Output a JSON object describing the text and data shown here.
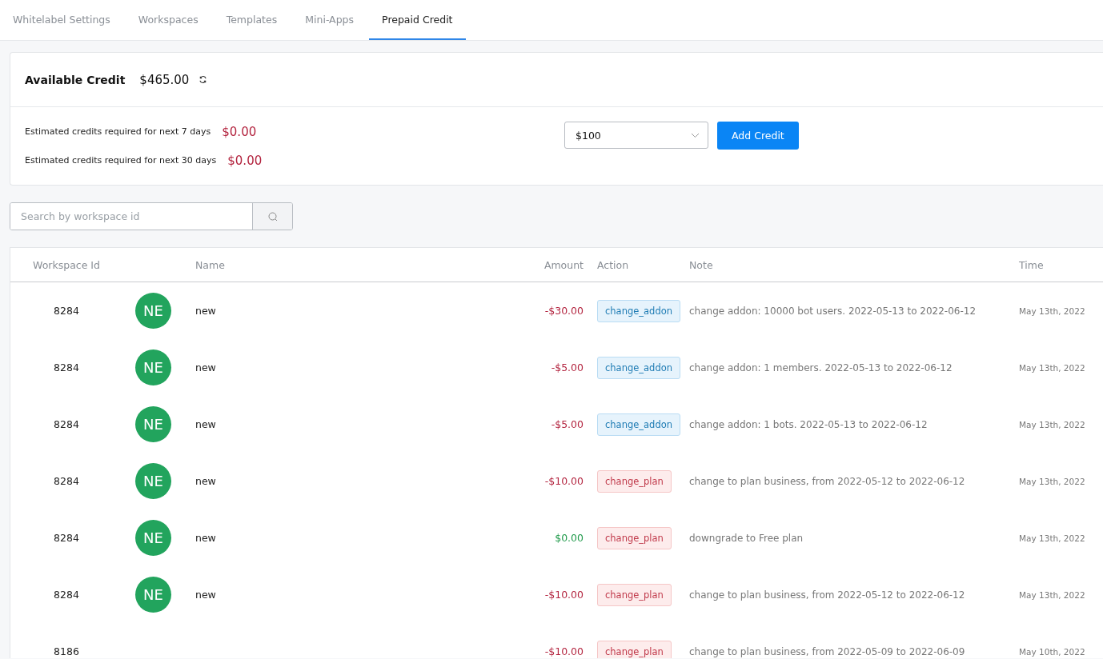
{
  "tabs": [
    {
      "label": "Whitelabel Settings",
      "selected": false
    },
    {
      "label": "Workspaces",
      "selected": false
    },
    {
      "label": "Templates",
      "selected": false
    },
    {
      "label": "Mini-Apps",
      "selected": false
    },
    {
      "label": "Prepaid Credit",
      "selected": true
    }
  ],
  "credit": {
    "label": "Available Credit",
    "amount": "$465.00",
    "estimates": [
      {
        "label": "Estimated credits required for next 7 days",
        "amount": "$0.00"
      },
      {
        "label": "Estimated credits required for next 30 days",
        "amount": "$0.00"
      }
    ],
    "select_value": "$100",
    "button": "Add Credit"
  },
  "search": {
    "placeholder": "Search by workspace id"
  },
  "table": {
    "columns": [
      "Workspace Id",
      "Name",
      "Amount",
      "Action",
      "Note",
      "Time"
    ],
    "rows": [
      {
        "workspace_id": "8284",
        "avatar": "NE",
        "name": "new",
        "amount": {
          "text": "-$30.00",
          "kind": "negative"
        },
        "action": {
          "text": "change_addon",
          "kind": "addon"
        },
        "note": "change addon: 10000 bot users. 2022-05-13 to 2022-06-12",
        "time": "May 13th, 2022"
      },
      {
        "workspace_id": "8284",
        "avatar": "NE",
        "name": "new",
        "amount": {
          "text": "-$5.00",
          "kind": "negative"
        },
        "action": {
          "text": "change_addon",
          "kind": "addon"
        },
        "note": "change addon: 1 members. 2022-05-13 to 2022-06-12",
        "time": "May 13th, 2022"
      },
      {
        "workspace_id": "8284",
        "avatar": "NE",
        "name": "new",
        "amount": {
          "text": "-$5.00",
          "kind": "negative"
        },
        "action": {
          "text": "change_addon",
          "kind": "addon"
        },
        "note": "change addon: 1 bots. 2022-05-13 to 2022-06-12",
        "time": "May 13th, 2022"
      },
      {
        "workspace_id": "8284",
        "avatar": "NE",
        "name": "new",
        "amount": {
          "text": "-$10.00",
          "kind": "negative"
        },
        "action": {
          "text": "change_plan",
          "kind": "plan"
        },
        "note": "change to plan business, from 2022-05-12 to 2022-06-12",
        "time": "May 13th, 2022"
      },
      {
        "workspace_id": "8284",
        "avatar": "NE",
        "name": "new",
        "amount": {
          "text": "$0.00",
          "kind": "zero"
        },
        "action": {
          "text": "change_plan",
          "kind": "plan"
        },
        "note": "downgrade to Free plan",
        "time": "May 13th, 2022"
      },
      {
        "workspace_id": "8284",
        "avatar": "NE",
        "name": "new",
        "amount": {
          "text": "-$10.00",
          "kind": "negative"
        },
        "action": {
          "text": "change_plan",
          "kind": "plan"
        },
        "note": "change to plan business, from 2022-05-12 to 2022-06-12",
        "time": "May 13th, 2022"
      },
      {
        "workspace_id": "8186",
        "amount": {
          "text": "-$10.00",
          "kind": "negative"
        },
        "action": {
          "text": "change_plan",
          "kind": "plan"
        },
        "note": "change to plan business, from 2022-05-09 to 2022-06-09",
        "time": "May 10th, 2022"
      }
    ]
  }
}
